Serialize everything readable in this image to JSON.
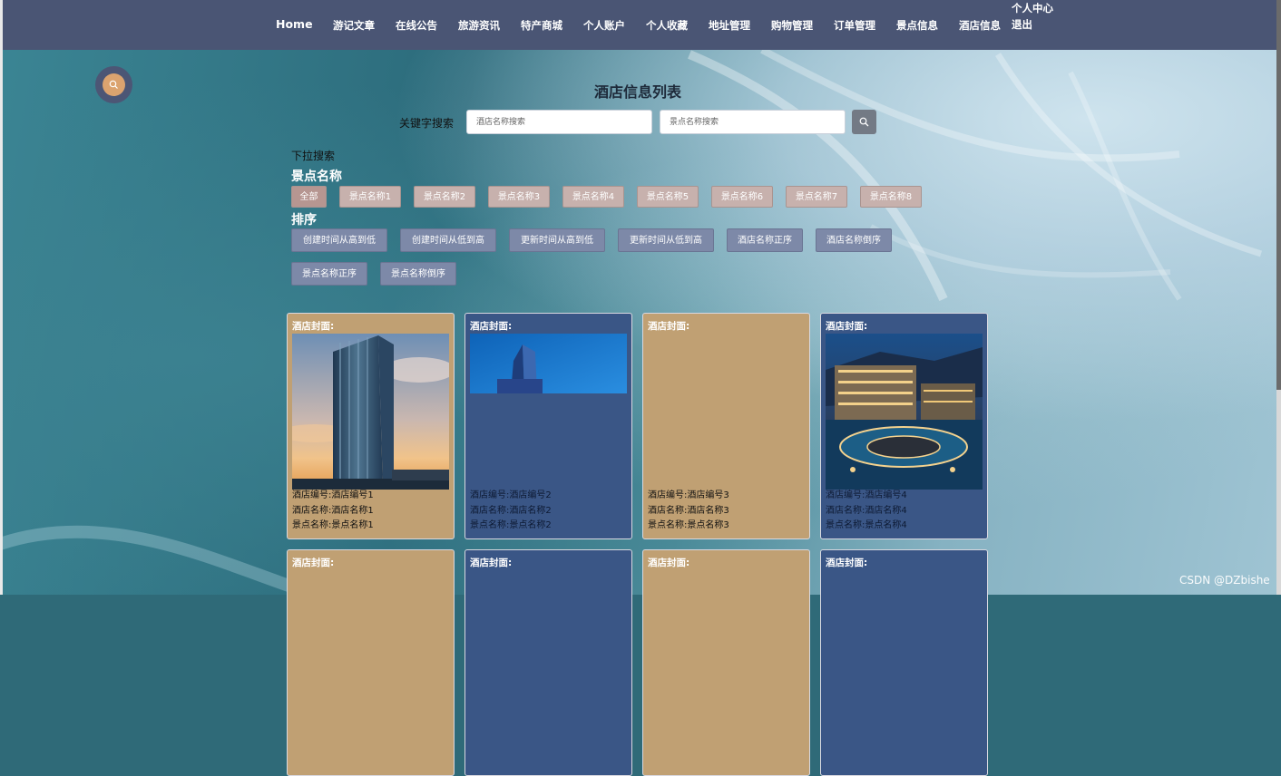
{
  "nav": {
    "items": [
      "Home",
      "游记文章",
      "在线公告",
      "旅游资讯",
      "特产商城",
      "个人账户",
      "个人收藏",
      "地址管理",
      "购物管理",
      "订单管理",
      "景点信息",
      "酒店信息"
    ],
    "user_center": "个人中心",
    "logout": "退出"
  },
  "page": {
    "title": "酒店信息列表"
  },
  "search": {
    "keyword_label": "关键字搜索",
    "hotel_name_placeholder": "酒店名称搜索",
    "spot_name_placeholder": "景点名称搜索",
    "button_icon": "search-icon"
  },
  "filters": {
    "dropdown_label": "下拉搜索",
    "spot_heading": "景点名称",
    "spot_options": [
      "全部",
      "景点名称1",
      "景点名称2",
      "景点名称3",
      "景点名称4",
      "景点名称5",
      "景点名称6",
      "景点名称7",
      "景点名称8"
    ],
    "sort_heading": "排序",
    "sort_options": [
      "创建时间从高到低",
      "创建时间从低到高",
      "更新时间从高到低",
      "更新时间从低到高",
      "酒店名称正序",
      "酒店名称倒序",
      "景点名称正序",
      "景点名称倒序"
    ]
  },
  "cards": [
    {
      "cover_label": "酒店封面:",
      "hotel_no": "酒店编号:酒店编号1",
      "hotel_name": "酒店名称:酒店名称1",
      "spot_name": "景点名称:景点名称1"
    },
    {
      "cover_label": "酒店封面:",
      "hotel_no": "酒店编号:酒店编号2",
      "hotel_name": "酒店名称:酒店名称2",
      "spot_name": "景点名称:景点名称2"
    },
    {
      "cover_label": "酒店封面:",
      "hotel_no": "酒店编号:酒店编号3",
      "hotel_name": "酒店名称:酒店名称3",
      "spot_name": "景点名称:景点名称3"
    },
    {
      "cover_label": "酒店封面:",
      "hotel_no": "酒店编号:酒店编号4",
      "hotel_name": "酒店名称:酒店名称4",
      "spot_name": "景点名称:景点名称4"
    },
    {
      "cover_label": "酒店封面:"
    },
    {
      "cover_label": "酒店封面:"
    },
    {
      "cover_label": "酒店封面:"
    },
    {
      "cover_label": "酒店封面:"
    }
  ],
  "colors": {
    "nav_bg": "#4a5574",
    "card_tan": "#c0a073",
    "card_blue": "#3a5686",
    "spot_btn": "#c7b1ad",
    "sort_btn": "#7d89a8",
    "float_button": "#dba36f"
  },
  "watermark": "CSDN @DZbishe"
}
